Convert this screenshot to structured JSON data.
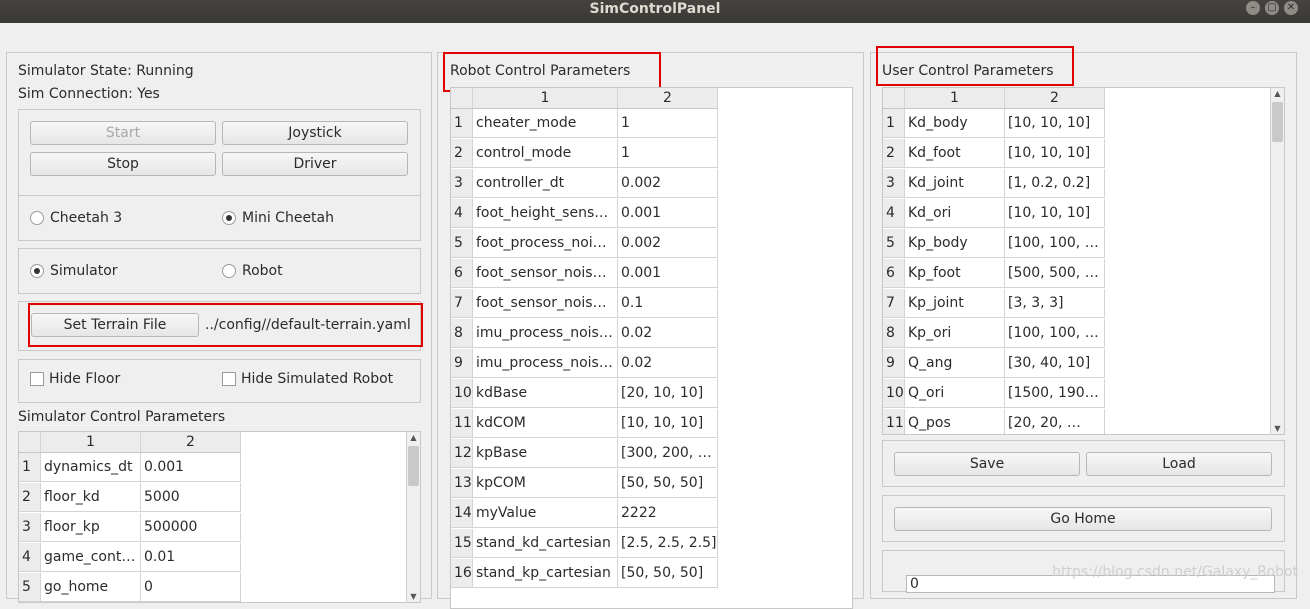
{
  "window": {
    "title": "SimControlPanel"
  },
  "left": {
    "state_label": "Simulator State: Running",
    "connection_label": "Sim Connection: Yes",
    "buttons": {
      "start": "Start",
      "joystick": "Joystick",
      "stop": "Stop",
      "driver": "Driver"
    },
    "robot_choice": {
      "cheetah3": "Cheetah 3",
      "mini_cheetah": "Mini Cheetah",
      "selected": "Mini Cheetah"
    },
    "mode_choice": {
      "simulator": "Simulator",
      "robot": "Robot",
      "selected": "Simulator"
    },
    "terrain": {
      "button": "Set Terrain File",
      "path": "../config//default-terrain.yaml"
    },
    "checks": {
      "hide_floor": "Hide Floor",
      "hide_robot": "Hide Simulated Robot"
    },
    "params_title": "Simulator Control Parameters",
    "table": {
      "columns": [
        "1",
        "2"
      ],
      "rows": [
        {
          "idx": "1",
          "name": "dynamics_dt",
          "value": "0.001"
        },
        {
          "idx": "2",
          "name": "floor_kd",
          "value": "5000"
        },
        {
          "idx": "3",
          "name": "floor_kp",
          "value": "500000"
        },
        {
          "idx": "4",
          "name": "game_cont…",
          "value": "0.01"
        },
        {
          "idx": "5",
          "name": "go_home",
          "value": "0"
        }
      ]
    }
  },
  "middle": {
    "title": "Robot Control Parameters",
    "table": {
      "columns": [
        "1",
        "2"
      ],
      "rows": [
        {
          "idx": "1",
          "name": "cheater_mode",
          "value": "1"
        },
        {
          "idx": "2",
          "name": "control_mode",
          "value": "1"
        },
        {
          "idx": "3",
          "name": "controller_dt",
          "value": "0.002"
        },
        {
          "idx": "4",
          "name": "foot_height_sens…",
          "value": "0.001"
        },
        {
          "idx": "5",
          "name": "foot_process_noi…",
          "value": "0.002"
        },
        {
          "idx": "6",
          "name": "foot_sensor_nois…",
          "value": "0.001"
        },
        {
          "idx": "7",
          "name": "foot_sensor_nois…",
          "value": "0.1"
        },
        {
          "idx": "8",
          "name": "imu_process_nois…",
          "value": "0.02"
        },
        {
          "idx": "9",
          "name": "imu_process_nois…",
          "value": "0.02"
        },
        {
          "idx": "10",
          "name": "kdBase",
          "value": "[20, 10, 10]"
        },
        {
          "idx": "11",
          "name": "kdCOM",
          "value": "[10, 10, 10]"
        },
        {
          "idx": "12",
          "name": "kpBase",
          "value": "[300, 200, …"
        },
        {
          "idx": "13",
          "name": "kpCOM",
          "value": "[50, 50, 50]"
        },
        {
          "idx": "14",
          "name": "myValue",
          "value": "2222"
        },
        {
          "idx": "15",
          "name": "stand_kd_cartesian",
          "value": "[2.5, 2.5, 2.5]"
        },
        {
          "idx": "16",
          "name": "stand_kp_cartesian",
          "value": "[50, 50, 50]"
        }
      ]
    }
  },
  "right": {
    "title": "User Control Parameters",
    "table": {
      "columns": [
        "1",
        "2"
      ],
      "rows": [
        {
          "idx": "1",
          "name": "Kd_body",
          "value": "[10, 10, 10]"
        },
        {
          "idx": "2",
          "name": "Kd_foot",
          "value": "[10, 10, 10]"
        },
        {
          "idx": "3",
          "name": "Kd_joint",
          "value": "[1, 0.2, 0.2]"
        },
        {
          "idx": "4",
          "name": "Kd_ori",
          "value": "[10, 10, 10]"
        },
        {
          "idx": "5",
          "name": "Kp_body",
          "value": "[100, 100, …"
        },
        {
          "idx": "6",
          "name": "Kp_foot",
          "value": "[500, 500, …"
        },
        {
          "idx": "7",
          "name": "Kp_joint",
          "value": "[3, 3, 3]"
        },
        {
          "idx": "8",
          "name": "Kp_ori",
          "value": "[100, 100, …"
        },
        {
          "idx": "9",
          "name": "Q_ang",
          "value": "[30, 40, 10]"
        },
        {
          "idx": "10",
          "name": "Q_ori",
          "value": "[1500, 190…"
        },
        {
          "idx": "11",
          "name": "Q_pos",
          "value": "[20, 20, …"
        }
      ]
    },
    "buttons": {
      "save": "Save",
      "load": "Load",
      "go_home": "Go Home"
    },
    "input_value": "0"
  },
  "watermark": "https://blog.csdn.net/Galaxy_Robot",
  "colors": {
    "highlight_border": "#e00000"
  }
}
